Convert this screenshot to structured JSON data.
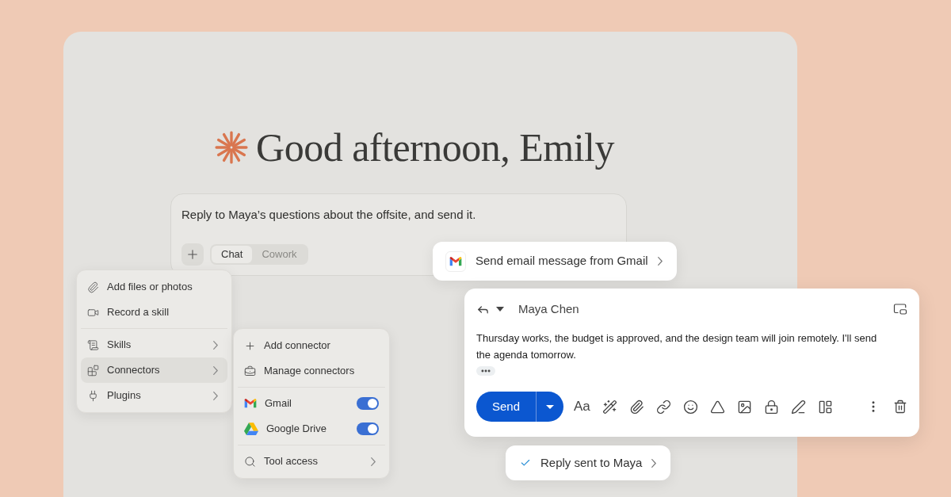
{
  "greeting": {
    "text": "Good afternoon, Emily"
  },
  "composer": {
    "prompt": "Reply to Maya’s questions about the offsite, and send it.",
    "modes": [
      {
        "label": "Chat",
        "selected": true
      },
      {
        "label": "Cowork",
        "selected": false
      }
    ]
  },
  "attach_menu": {
    "sections": [
      [
        {
          "label": "Add files or photos",
          "submenu": false,
          "selected": false
        },
        {
          "label": "Record a skill",
          "submenu": false,
          "selected": false
        }
      ],
      [
        {
          "label": "Skills",
          "submenu": true,
          "selected": false
        },
        {
          "label": "Connectors",
          "submenu": true,
          "selected": true
        },
        {
          "label": "Plugins",
          "submenu": true,
          "selected": false
        }
      ]
    ]
  },
  "connector_menu": {
    "sections": [
      [
        {
          "kind": "action",
          "label": "Add connector"
        },
        {
          "kind": "action",
          "label": "Manage connectors"
        }
      ],
      [
        {
          "kind": "toggle",
          "label": "Gmail",
          "on": true
        },
        {
          "kind": "toggle",
          "label": "Google Drive",
          "on": true
        }
      ],
      [
        {
          "kind": "submenu",
          "label": "Tool access"
        }
      ]
    ]
  },
  "gmail_chip": {
    "label": "Send email message from Gmail"
  },
  "email": {
    "recipient": "Maya Chen",
    "body": "Thursday works, the budget is approved, and the design team will join remotely. I'll send the agenda tomorrow.",
    "send_label": "Send",
    "format_label": "Aa"
  },
  "status_chip": {
    "label": "Reply sent to Maya",
    "done": true
  }
}
